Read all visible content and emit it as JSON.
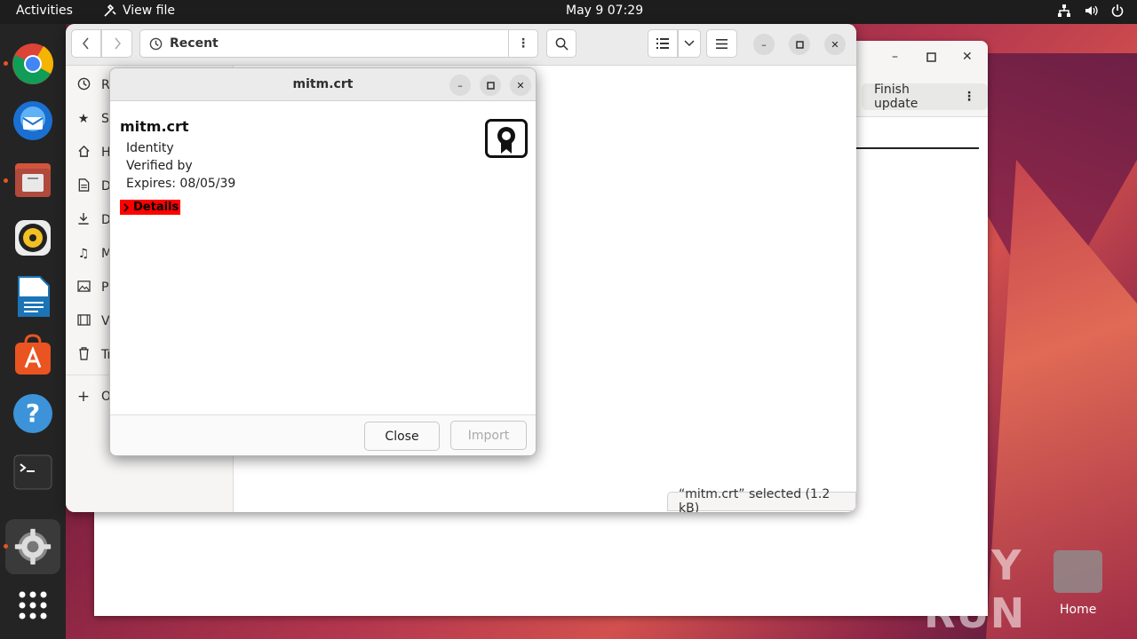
{
  "topbar": {
    "activities": "Activities",
    "app_menu": "View file",
    "clock": "May 9  07:29"
  },
  "dock": {
    "items": [
      "chrome-icon",
      "thunderbird-icon",
      "files-icon",
      "rhythmbox-icon",
      "writer-icon",
      "app-center-icon",
      "help-icon",
      "terminal-icon",
      "settings-icon",
      "app-grid-icon"
    ]
  },
  "bg_window": {
    "finish_update_label": "Finish update"
  },
  "nautilus": {
    "location": "Recent",
    "sidebar": [
      {
        "label": "Re",
        "icon": "recent-icon"
      },
      {
        "label": "St",
        "icon": "star-icon"
      },
      {
        "label": "Ho",
        "icon": "home-icon"
      },
      {
        "label": "Do",
        "icon": "documents-icon"
      },
      {
        "label": "Do",
        "icon": "downloads-icon"
      },
      {
        "label": "M",
        "icon": "music-icon"
      },
      {
        "label": "Pi",
        "icon": "pictures-icon"
      },
      {
        "label": "Vi",
        "icon": "videos-icon"
      },
      {
        "label": "Tr",
        "icon": "trash-icon"
      },
      {
        "label": "O",
        "icon": "plus-icon"
      }
    ],
    "status": "“mitm.crt” selected  (1.2 kB)"
  },
  "dialog": {
    "title": "mitm.crt",
    "cert_name": "mitm.crt",
    "identity": "Identity",
    "verified_by": "Verified by",
    "expires": "Expires: 08/05/39",
    "details_label": "Details",
    "close_label": "Close",
    "import_label": "Import"
  },
  "desktop": {
    "home_label": "Home",
    "watermark": "ANY RUN"
  },
  "colors": {
    "accent": "#e95420",
    "details_highlight": "#ff0000"
  }
}
